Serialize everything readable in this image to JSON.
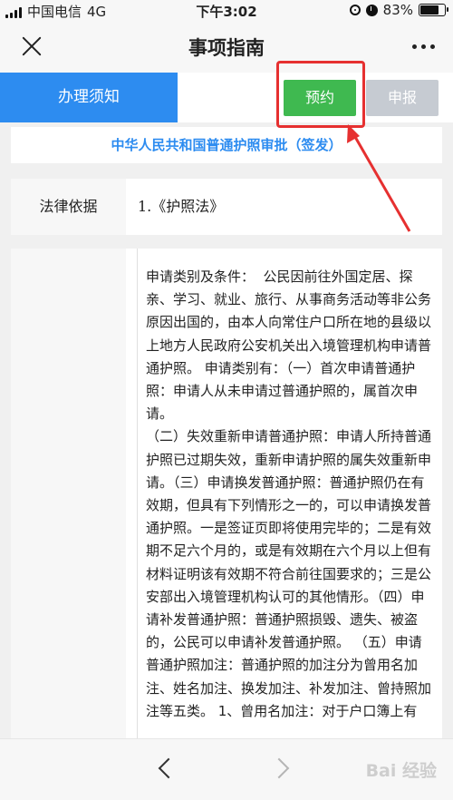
{
  "status_bar": {
    "carrier": "中国电信",
    "network": "4G",
    "time": "下午3:02",
    "battery": "83%",
    "battery_level": 0.83
  },
  "nav": {
    "title": "事项指南"
  },
  "tabs": {
    "notice": "办理须知",
    "reserve": "预约",
    "apply": "申报"
  },
  "content": {
    "service_title": "中华人民共和国普通护照审批（签发）",
    "law_label": "法律依据",
    "law_value": "1.《护照法》",
    "conditions_text": "申请类别及条件：  公民因前往外国定居、探亲、学习、就业、旅行、从事商务活动等非公务原因出国的，由本人向常住户口所在地的县级以上地方人民政府公安机关出入境管理机构申请普通护照。 申请类别有：（一）首次申请普通护照：申请人从未申请过普通护照的，属首次申请。\n（二）失效重新申请普通护照：申请人所持普通护照已过期失效，重新申请护照的属失效重新申请。（三）申请换发普通护照：普通护照仍在有效期，但具有下列情形之一的，可以申请换发普通护照。一是签证页即将使用完毕的；二是有效期不足六个月的，或是有效期在六个月以上但有材料证明该有效期不符合前往国要求的；三是公安部出入境管理机构认可的其他情形。（四）申请补发普通护照：普通护照损毁、遗失、被盗的，公民可以申请补发普通护照。 （五）申请普通护照加注：普通护照的加注分为曾用名加注、姓名加注、换发加注、补发加注、曾持照加注等五类。 1、曾用名加注：对于户口簿上有"
  },
  "watermark": "Bai 经验"
}
